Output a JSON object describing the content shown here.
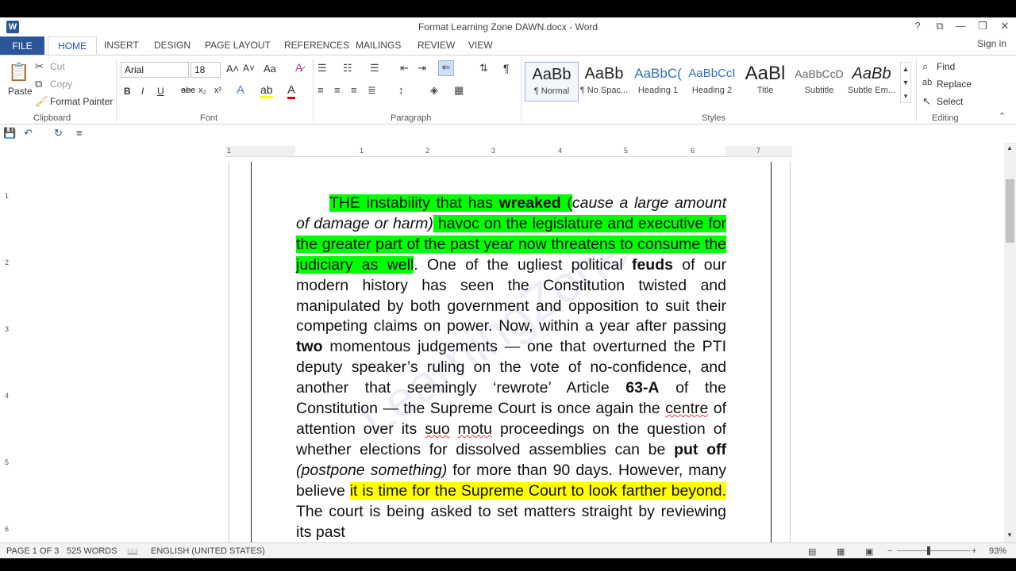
{
  "window": {
    "title": "Format Learning Zone DAWN.docx - Word",
    "app_icon": "W",
    "controls": {
      "help": "?",
      "restore_ribbon": "⧉",
      "minimize": "—",
      "maximize": "❐",
      "close": "✕"
    }
  },
  "tabs": [
    "FILE",
    "HOME",
    "INSERT",
    "DESIGN",
    "PAGE LAYOUT",
    "REFERENCES",
    "MAILINGS",
    "REVIEW",
    "VIEW"
  ],
  "signin": "Sign in",
  "clipboard": {
    "paste": "Paste",
    "cut": "Cut",
    "copy": "Copy",
    "format_painter": "Format Painter",
    "label": "Clipboard"
  },
  "font": {
    "name": "Arial",
    "size": "18",
    "label": "Font",
    "bold": "B",
    "italic": "I",
    "underline": "U",
    "strike": "abc",
    "sub": "x₂",
    "sup": "x²",
    "case": "Aa"
  },
  "paragraph": {
    "label": "Paragraph",
    "pilcrow": "¶"
  },
  "styles": {
    "label": "Styles",
    "items": [
      {
        "preview": "AaBb",
        "name": "¶ Normal"
      },
      {
        "preview": "AaBb",
        "name": "¶ No Spac..."
      },
      {
        "preview": "AaBbC(",
        "name": "Heading 1"
      },
      {
        "preview": "AaBbCcI",
        "name": "Heading 2"
      },
      {
        "preview": "AaBl",
        "name": "Title"
      },
      {
        "preview": "AaBbCcD",
        "name": "Subtitle"
      },
      {
        "preview": "AaBb",
        "name": "Subtle Em..."
      }
    ]
  },
  "editing": {
    "label": "Editing",
    "find": "Find",
    "replace": "Replace",
    "select": "Select"
  },
  "ruler": {
    "h": [
      "1",
      "1",
      "2",
      "3",
      "4",
      "5",
      "6",
      "7"
    ],
    "v": [
      "1",
      "2",
      "3",
      "4",
      "5",
      "6"
    ]
  },
  "document": {
    "watermark": "LearningZone",
    "segments": [
      {
        "t": "THE instability that has ",
        "hl": "green"
      },
      {
        "t": "wreaked",
        "hl": "green",
        "b": true
      },
      {
        "t": " (",
        "hl": "green"
      },
      {
        "t": "cause a large amount of damage or harm)",
        "i": true
      },
      {
        "t": " havoc on the legislature and executive for the greater part of the past year now threatens to consume the judiciary as well",
        "hl": "green"
      },
      {
        "t": ". One of the ugliest political "
      },
      {
        "t": "feuds",
        "b": true
      },
      {
        "t": " of our modern history has seen the Constitution twisted and manipulated by both government and opposition to suit their competing claims on power. Now, within a year after passing "
      },
      {
        "t": "two",
        "b": true
      },
      {
        "t": " momentous judgements — one that overturned the PTI deputy speaker’s ruling on the vote of no-confidence, and another that seemingly ‘rewrote’ Article "
      },
      {
        "t": "63-A",
        "b": true
      },
      {
        "t": " of the Constitution — the Supreme Court is once again the "
      },
      {
        "t": "centre",
        "sq": true
      },
      {
        "t": " of attention over its "
      },
      {
        "t": "suo",
        "sq": true
      },
      {
        "t": " "
      },
      {
        "t": "motu",
        "sq": true
      },
      {
        "t": " proceedings on the question of whether elections for dissolved assemblies can be "
      },
      {
        "t": "put off",
        "b": true
      },
      {
        "t": " "
      },
      {
        "t": "(postpone something)",
        "i": true
      },
      {
        "t": " for more than 90 days. However, many believe "
      },
      {
        "t": "it is time for the Supreme Court to look farther beyond.",
        "hl": "yellow"
      },
      {
        "t": " The court is being asked to set matters straight by reviewing its past"
      }
    ]
  },
  "status": {
    "page": "PAGE 1 OF 3",
    "words": "525 WORDS",
    "language": "ENGLISH (UNITED STATES)",
    "zoom": "93%",
    "zoom_minus": "−",
    "zoom_plus": "+"
  }
}
